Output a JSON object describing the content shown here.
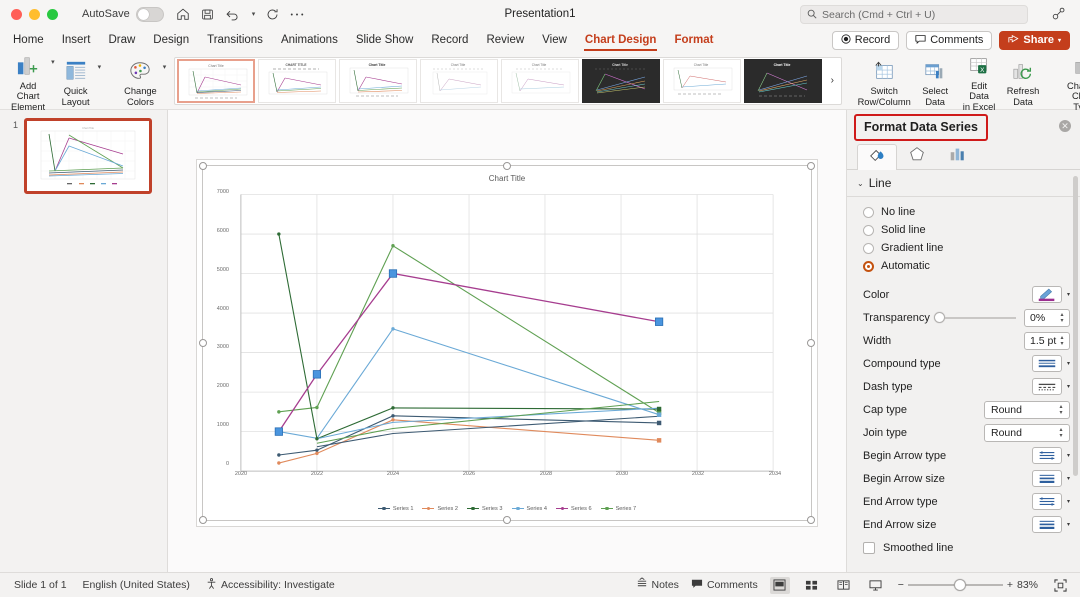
{
  "titlebar": {
    "autosave_label": "AutoSave",
    "document_title": "Presentation1",
    "search_placeholder": "Search (Cmd + Ctrl + U)",
    "icons": [
      "home-icon",
      "save-icon",
      "undo-icon",
      "redo-icon",
      "more-icon"
    ]
  },
  "tabs": [
    {
      "label": "Home",
      "accent": false,
      "active": false
    },
    {
      "label": "Insert",
      "accent": false,
      "active": false
    },
    {
      "label": "Draw",
      "accent": false,
      "active": false
    },
    {
      "label": "Design",
      "accent": false,
      "active": false
    },
    {
      "label": "Transitions",
      "accent": false,
      "active": false
    },
    {
      "label": "Animations",
      "accent": false,
      "active": false
    },
    {
      "label": "Slide Show",
      "accent": false,
      "active": false
    },
    {
      "label": "Record",
      "accent": false,
      "active": false
    },
    {
      "label": "Review",
      "accent": false,
      "active": false
    },
    {
      "label": "View",
      "accent": false,
      "active": false
    },
    {
      "label": "Chart Design",
      "accent": true,
      "active": true
    },
    {
      "label": "Format",
      "accent": true,
      "active": false
    }
  ],
  "tabbar_right": {
    "record_label": "Record",
    "comments_label": "Comments",
    "share_label": "Share"
  },
  "ribbon": {
    "buttons": [
      {
        "label": "Add Chart\nElement",
        "icon": "add-chart-element-icon",
        "caret": true
      },
      {
        "label": "Quick\nLayout",
        "icon": "quick-layout-icon",
        "caret": true
      },
      {
        "label": "Change\nColors",
        "icon": "change-colors-icon",
        "caret": true
      }
    ],
    "data_buttons": [
      {
        "label": "Switch\nRow/Column",
        "icon": "switch-row-column-icon",
        "caret": false
      },
      {
        "label": "Select\nData",
        "icon": "select-data-icon",
        "caret": false
      },
      {
        "label": "Edit Data\nin Excel",
        "icon": "edit-data-excel-icon",
        "caret": false
      },
      {
        "label": "Refresh\nData",
        "icon": "refresh-data-icon",
        "caret": false
      },
      {
        "label": "Change\nChart Type",
        "icon": "change-chart-type-icon",
        "caret": true
      }
    ],
    "gallery_more": "›",
    "style_count": 8
  },
  "slide_panel": {
    "slide_number": "1"
  },
  "chart_data": {
    "type": "line",
    "title": "Chart Title",
    "xlabel": "",
    "ylabel": "",
    "xlim": [
      2020,
      2034
    ],
    "ylim": [
      0,
      7000
    ],
    "x_ticks": [
      "2020",
      "2022",
      "2024",
      "2026",
      "2028",
      "2030",
      "2032",
      "2034"
    ],
    "y_ticks": [
      "0",
      "1000",
      "2000",
      "3000",
      "4000",
      "5000",
      "6000",
      "7000"
    ],
    "grid": true,
    "legend_position": "bottom",
    "x": [
      2021,
      2022,
      2024,
      2033
    ],
    "series": [
      {
        "name": "Series 1",
        "color": "#3d5a72",
        "values": [
          410,
          530,
          1400,
          1220
        ]
      },
      {
        "name": "Series 2",
        "color": "#e08a5c",
        "values": [
          205,
          450,
          1300,
          780
        ]
      },
      {
        "name": "Series 3",
        "color": "#2e6b35",
        "values": [
          6000,
          820,
          1600,
          1570
        ]
      },
      {
        "name": "Series 4",
        "color": "#6aa9d6",
        "values": [
          1000,
          830,
          3600,
          1430
        ]
      },
      {
        "name": "Series 6",
        "color": "#a63d8f",
        "values": [
          1000,
          2450,
          5000,
          3780
        ]
      },
      {
        "name": "Series 7",
        "color": "#5fa052",
        "values": [
          1500,
          1610,
          5700,
          1480
        ]
      }
    ],
    "selected_series": "Series 6",
    "selected_points": [
      [
        2021,
        1000
      ],
      [
        2022,
        2450
      ],
      [
        2024,
        5000
      ],
      [
        2033,
        3780
      ]
    ]
  },
  "right_panel": {
    "title": "Format Data Series",
    "close_icon": "close-icon",
    "tabs": [
      {
        "icon": "fill-line-icon",
        "active": true
      },
      {
        "icon": "effects-pentagon-icon",
        "active": false
      },
      {
        "icon": "series-options-chart-icon",
        "active": false
      }
    ],
    "section": {
      "title": "Line",
      "expanded": true
    },
    "line_options": [
      {
        "label": "No line",
        "selected": false
      },
      {
        "label": "Solid line",
        "selected": false
      },
      {
        "label": "Gradient line",
        "selected": false
      },
      {
        "label": "Automatic",
        "selected": true
      }
    ],
    "properties": [
      {
        "label": "Color",
        "type": "swatch",
        "value": "",
        "icon": "pen-color-icon",
        "swatch_color": "#9b2f8f"
      },
      {
        "label": "Transparency",
        "type": "slider-spin",
        "value": "0%"
      },
      {
        "label": "Width",
        "type": "spin",
        "value": "1.5 pt"
      },
      {
        "label": "Compound type",
        "type": "button",
        "value": "",
        "icon": "compound-type-icon"
      },
      {
        "label": "Dash type",
        "type": "button",
        "value": "",
        "icon": "dash-type-icon"
      },
      {
        "label": "Cap type",
        "type": "select",
        "value": "Round"
      },
      {
        "label": "Join type",
        "type": "select",
        "value": "Round"
      },
      {
        "label": "Begin Arrow type",
        "type": "button",
        "value": "",
        "icon": "begin-arrow-type-icon"
      },
      {
        "label": "Begin Arrow size",
        "type": "button",
        "value": "",
        "icon": "begin-arrow-size-icon"
      },
      {
        "label": "End Arrow type",
        "type": "button",
        "value": "",
        "icon": "end-arrow-type-icon"
      },
      {
        "label": "End Arrow size",
        "type": "button",
        "value": "",
        "icon": "end-arrow-size-icon"
      }
    ],
    "smoothed_line": {
      "label": "Smoothed line",
      "checked": false
    }
  },
  "statusbar": {
    "slide_count": "Slide 1 of 1",
    "language": "English (United States)",
    "accessibility": "Accessibility: Investigate",
    "notes_label": "Notes",
    "comments_label": "Comments",
    "zoom_level": "83%",
    "zoom_minus": "−",
    "zoom_plus": "+"
  },
  "colors": {
    "accent": "#c43e1c",
    "highlight_box": "#cf1a1a",
    "selection_blue": "#3b8ede",
    "radio_on": "#c4520f"
  }
}
